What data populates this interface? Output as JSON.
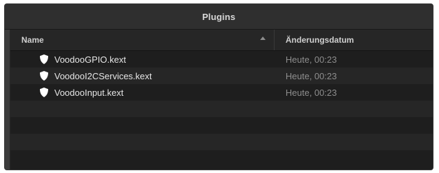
{
  "window": {
    "title": "Plugins"
  },
  "columns": {
    "name": "Name",
    "date": "Änderungsdatum",
    "sort": "ascending"
  },
  "files": [
    {
      "name": "VoodooGPIO.kext",
      "date": "Heute, 00:23",
      "icon": "kext-shield-icon"
    },
    {
      "name": "VoodooI2CServices.kext",
      "date": "Heute, 00:23",
      "icon": "kext-shield-icon"
    },
    {
      "name": "VoodooInput.kext",
      "date": "Heute, 00:23",
      "icon": "kext-shield-icon"
    }
  ],
  "colors": {
    "window_bg": "#1e1e1e",
    "alt_row_bg": "#262626",
    "titlebar_bg": "#2f2f2f",
    "file_text": "#e6e6e6",
    "date_text": "#8e8e8e"
  }
}
